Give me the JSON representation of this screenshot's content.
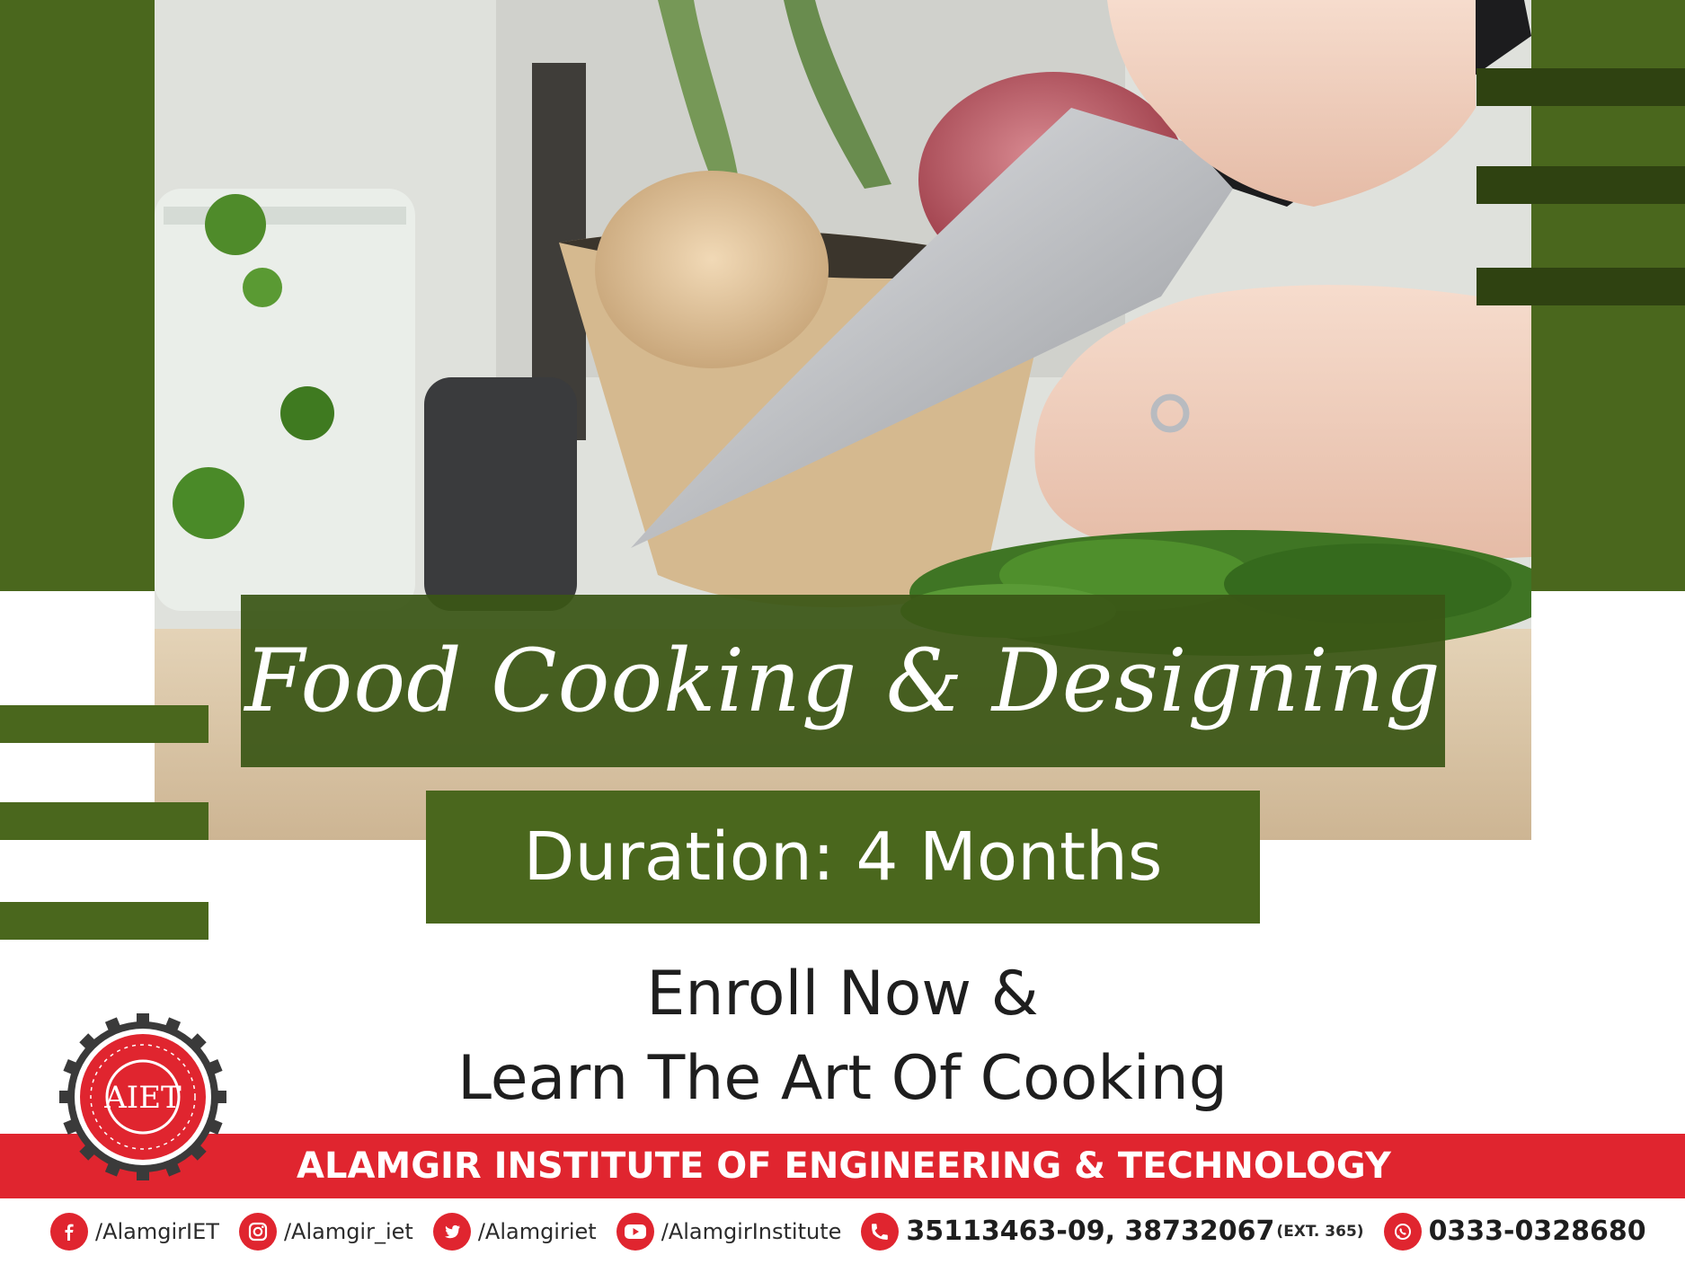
{
  "title": "Food Cooking & Designing",
  "duration": "Duration: 4 Months",
  "enroll": {
    "line1": "Enroll Now &",
    "line2": "Learn The Art Of Cooking"
  },
  "institute": {
    "name": "ALAMGIR INSTITUTE OF ENGINEERING & TECHNOLOGY",
    "logo_text": "AIET"
  },
  "social": [
    {
      "icon": "facebook-icon",
      "text": "/AlamgirIET"
    },
    {
      "icon": "instagram-icon",
      "text": "/Alamgir_iet"
    },
    {
      "icon": "twitter-icon",
      "text": "/Alamgiriet"
    },
    {
      "icon": "youtube-icon",
      "text": "/AlamgirInstitute"
    }
  ],
  "phone": {
    "icon": "phone-icon",
    "numbers": "35113463-09, 38732067",
    "ext": "(EXT. 365)"
  },
  "whatsapp": {
    "icon": "whatsapp-icon",
    "number": "0333-0328680"
  },
  "colors": {
    "green": "#4a671d",
    "dark_green": "#2f4211",
    "red": "#e0252f"
  }
}
